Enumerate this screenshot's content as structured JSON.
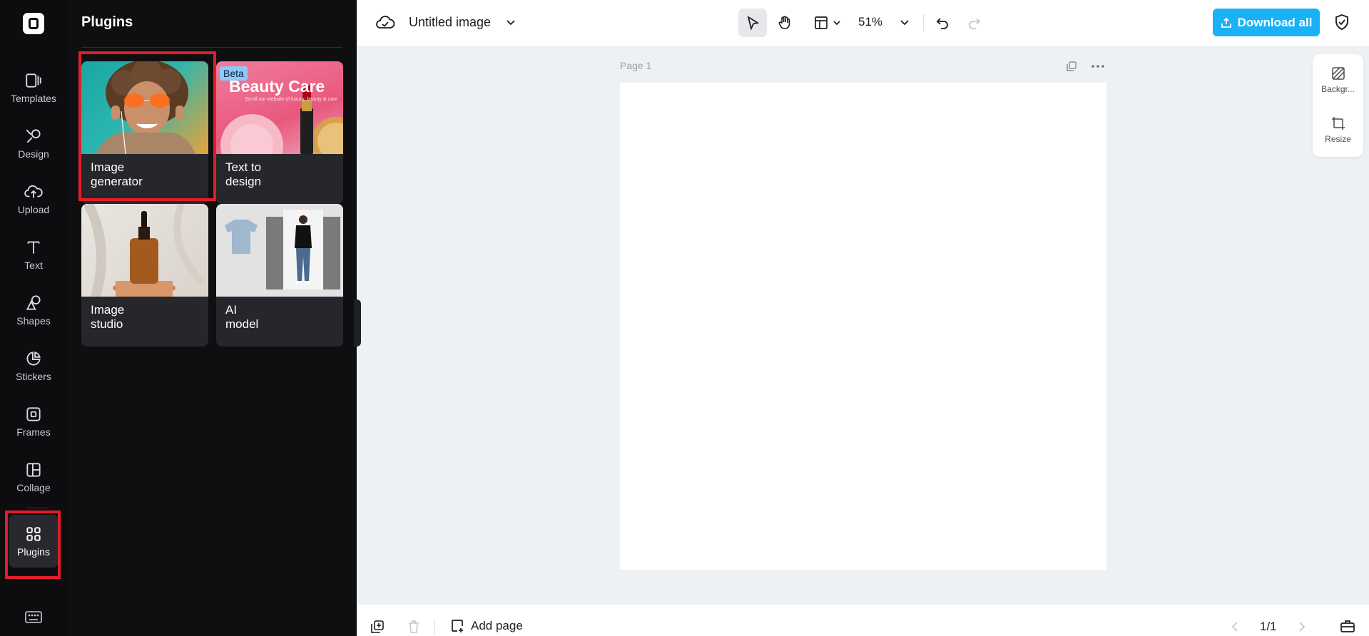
{
  "sidebar": {
    "items": [
      {
        "label": "Templates",
        "icon": "templates-icon"
      },
      {
        "label": "Design",
        "icon": "design-icon"
      },
      {
        "label": "Upload",
        "icon": "upload-icon"
      },
      {
        "label": "Text",
        "icon": "text-icon"
      },
      {
        "label": "Shapes",
        "icon": "shapes-icon"
      },
      {
        "label": "Stickers",
        "icon": "stickers-icon"
      },
      {
        "label": "Frames",
        "icon": "frames-icon"
      },
      {
        "label": "Collage",
        "icon": "collage-icon"
      }
    ],
    "active": {
      "label": "Plugins",
      "icon": "plugins-icon"
    }
  },
  "panel": {
    "title": "Plugins",
    "cards": [
      {
        "label": "Image generator",
        "line1": "Image",
        "line2": "generator"
      },
      {
        "label": "Text to design",
        "line1": "Text to",
        "line2": "design",
        "badge": "Beta",
        "thumb_title": "Beauty Care",
        "thumb_sub": "Scroll our website of luxury, beauty & care"
      },
      {
        "label": "Image studio",
        "line1": "Image",
        "line2": "studio"
      },
      {
        "label": "AI model",
        "line1": "AI",
        "line2": "model"
      }
    ]
  },
  "topbar": {
    "title": "Untitled image",
    "zoom": "51%",
    "download_label": "Download all"
  },
  "canvas": {
    "page_label": "Page 1"
  },
  "right_panel": {
    "items": [
      {
        "label": "Backgr..."
      },
      {
        "label": "Resize"
      }
    ]
  },
  "bottombar": {
    "add_page_label": "Add page",
    "page_counter": "1/1"
  },
  "colors": {
    "accent": "#1ab1f5",
    "highlight": "#e11d2a",
    "rail_bg": "#0d0d0f",
    "canvas_bg": "#eef1f4"
  }
}
